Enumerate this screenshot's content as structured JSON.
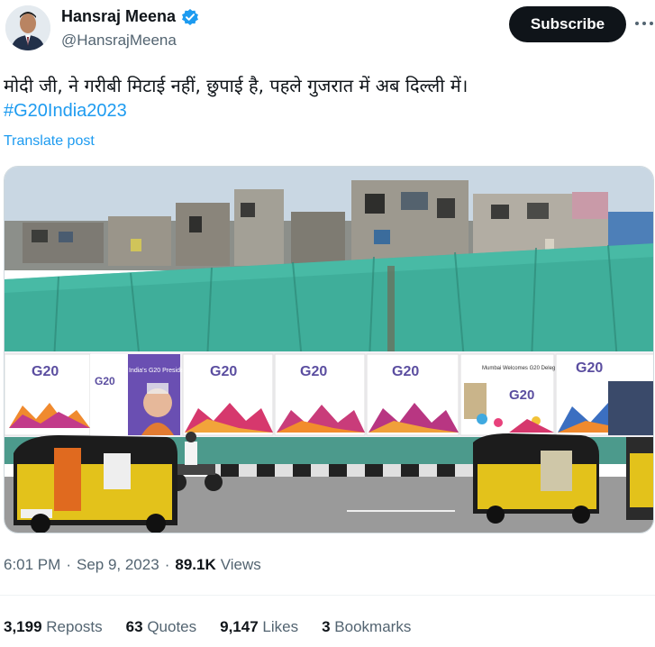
{
  "author": {
    "display_name": "Hansraj Meena",
    "handle": "@HansrajMeena",
    "verified": true
  },
  "subscribe_label": "Subscribe",
  "tweet": {
    "text": "मोदी जी, ने गरीबी मिटाई नहीं, छुपाई है, पहले गुजरात में अब दिल्ली में।",
    "hashtag": "#G20India2023",
    "translate_label": "Translate post"
  },
  "media": {
    "banner_logo": "G20",
    "banner_presidency": "India's G20 Presidency",
    "banner_mumbai": "Mumbai Welcomes G20 Delegates"
  },
  "meta": {
    "time": "6:01 PM",
    "separator": "·",
    "date": "Sep 9, 2023",
    "views_count": "89.1K",
    "views_label": "Views"
  },
  "stats": {
    "reposts_count": "3,199",
    "reposts_label": "Reposts",
    "quotes_count": "63",
    "quotes_label": "Quotes",
    "likes_count": "9,147",
    "likes_label": "Likes",
    "bookmarks_count": "3",
    "bookmarks_label": "Bookmarks"
  },
  "colors": {
    "accent": "#1d9bf0",
    "text": "#0f1419",
    "muted": "#536471",
    "tarp": "#3fae9a"
  },
  "icons": [
    "verified-icon",
    "more-icon"
  ]
}
